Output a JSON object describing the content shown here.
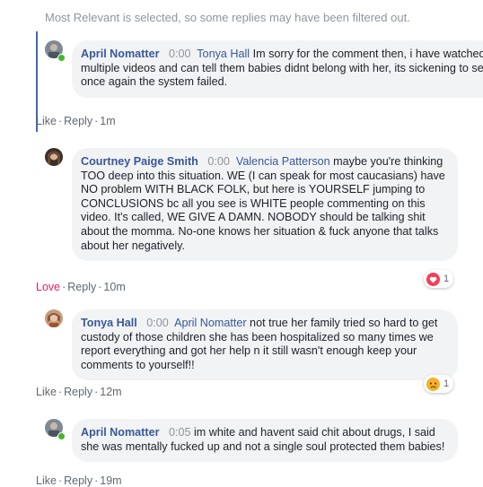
{
  "notice": "Most Relevant is selected, so some replies may have been filtered out.",
  "colors": {
    "link_blue": "#385898",
    "thread_line": "#4267b2",
    "bubble_bg": "#f2f3f5",
    "love": "#e0245e",
    "online": "#42b72a"
  },
  "comments": [
    {
      "author": "April Nomatter",
      "time": "0:00",
      "mention": "Tonya Hall",
      "text": " Im sorry for the comment then, i have watched multiple videos and can tell them babies didnt belong with her, its sickening to see once again the system failed.",
      "actions": {
        "react": "Like",
        "reply": "Reply",
        "age": "1m"
      }
    },
    {
      "author": "Courtney Paige Smith",
      "time": "0:00",
      "mention": "Valencia Patterson",
      "text": " maybe you're thinking TOO deep into this situation. WE (I can speak for most caucasians) have NO problem WITH BLACK FOLK, but here is YOURSELF jumping to CONCLUSIONS bc all you see is WHITE people commenting on this video. It's called, WE GIVE A DAMN. NOBODY should be talking shit about the momma. No-one knows her situation & fuck anyone that talks about her negatively.",
      "actions": {
        "react": "Love",
        "reply": "Reply",
        "age": "10m"
      },
      "reaction": {
        "icon": "love-reaction-icon",
        "count": "1"
      }
    },
    {
      "author": "Tonya Hall",
      "time": "0:00",
      "mention": "April Nomatter",
      "text": " not true her family tried so hard to get custody of those children she has been hospitalized so many times we report everything and got her help n it still wasn't enough keep your comments to yourself!!",
      "actions": {
        "react": "Like",
        "reply": "Reply",
        "age": "12m"
      },
      "reaction": {
        "icon": "sad-reaction-icon",
        "count": "1"
      }
    },
    {
      "author": "April Nomatter",
      "time": "0:05",
      "mention": "",
      "text": " im white and havent said chit about drugs, I said she was mentally fucked up and not a single soul protected them babies!",
      "actions": {
        "react": "Like",
        "reply": "Reply",
        "age": "19m"
      }
    }
  ]
}
